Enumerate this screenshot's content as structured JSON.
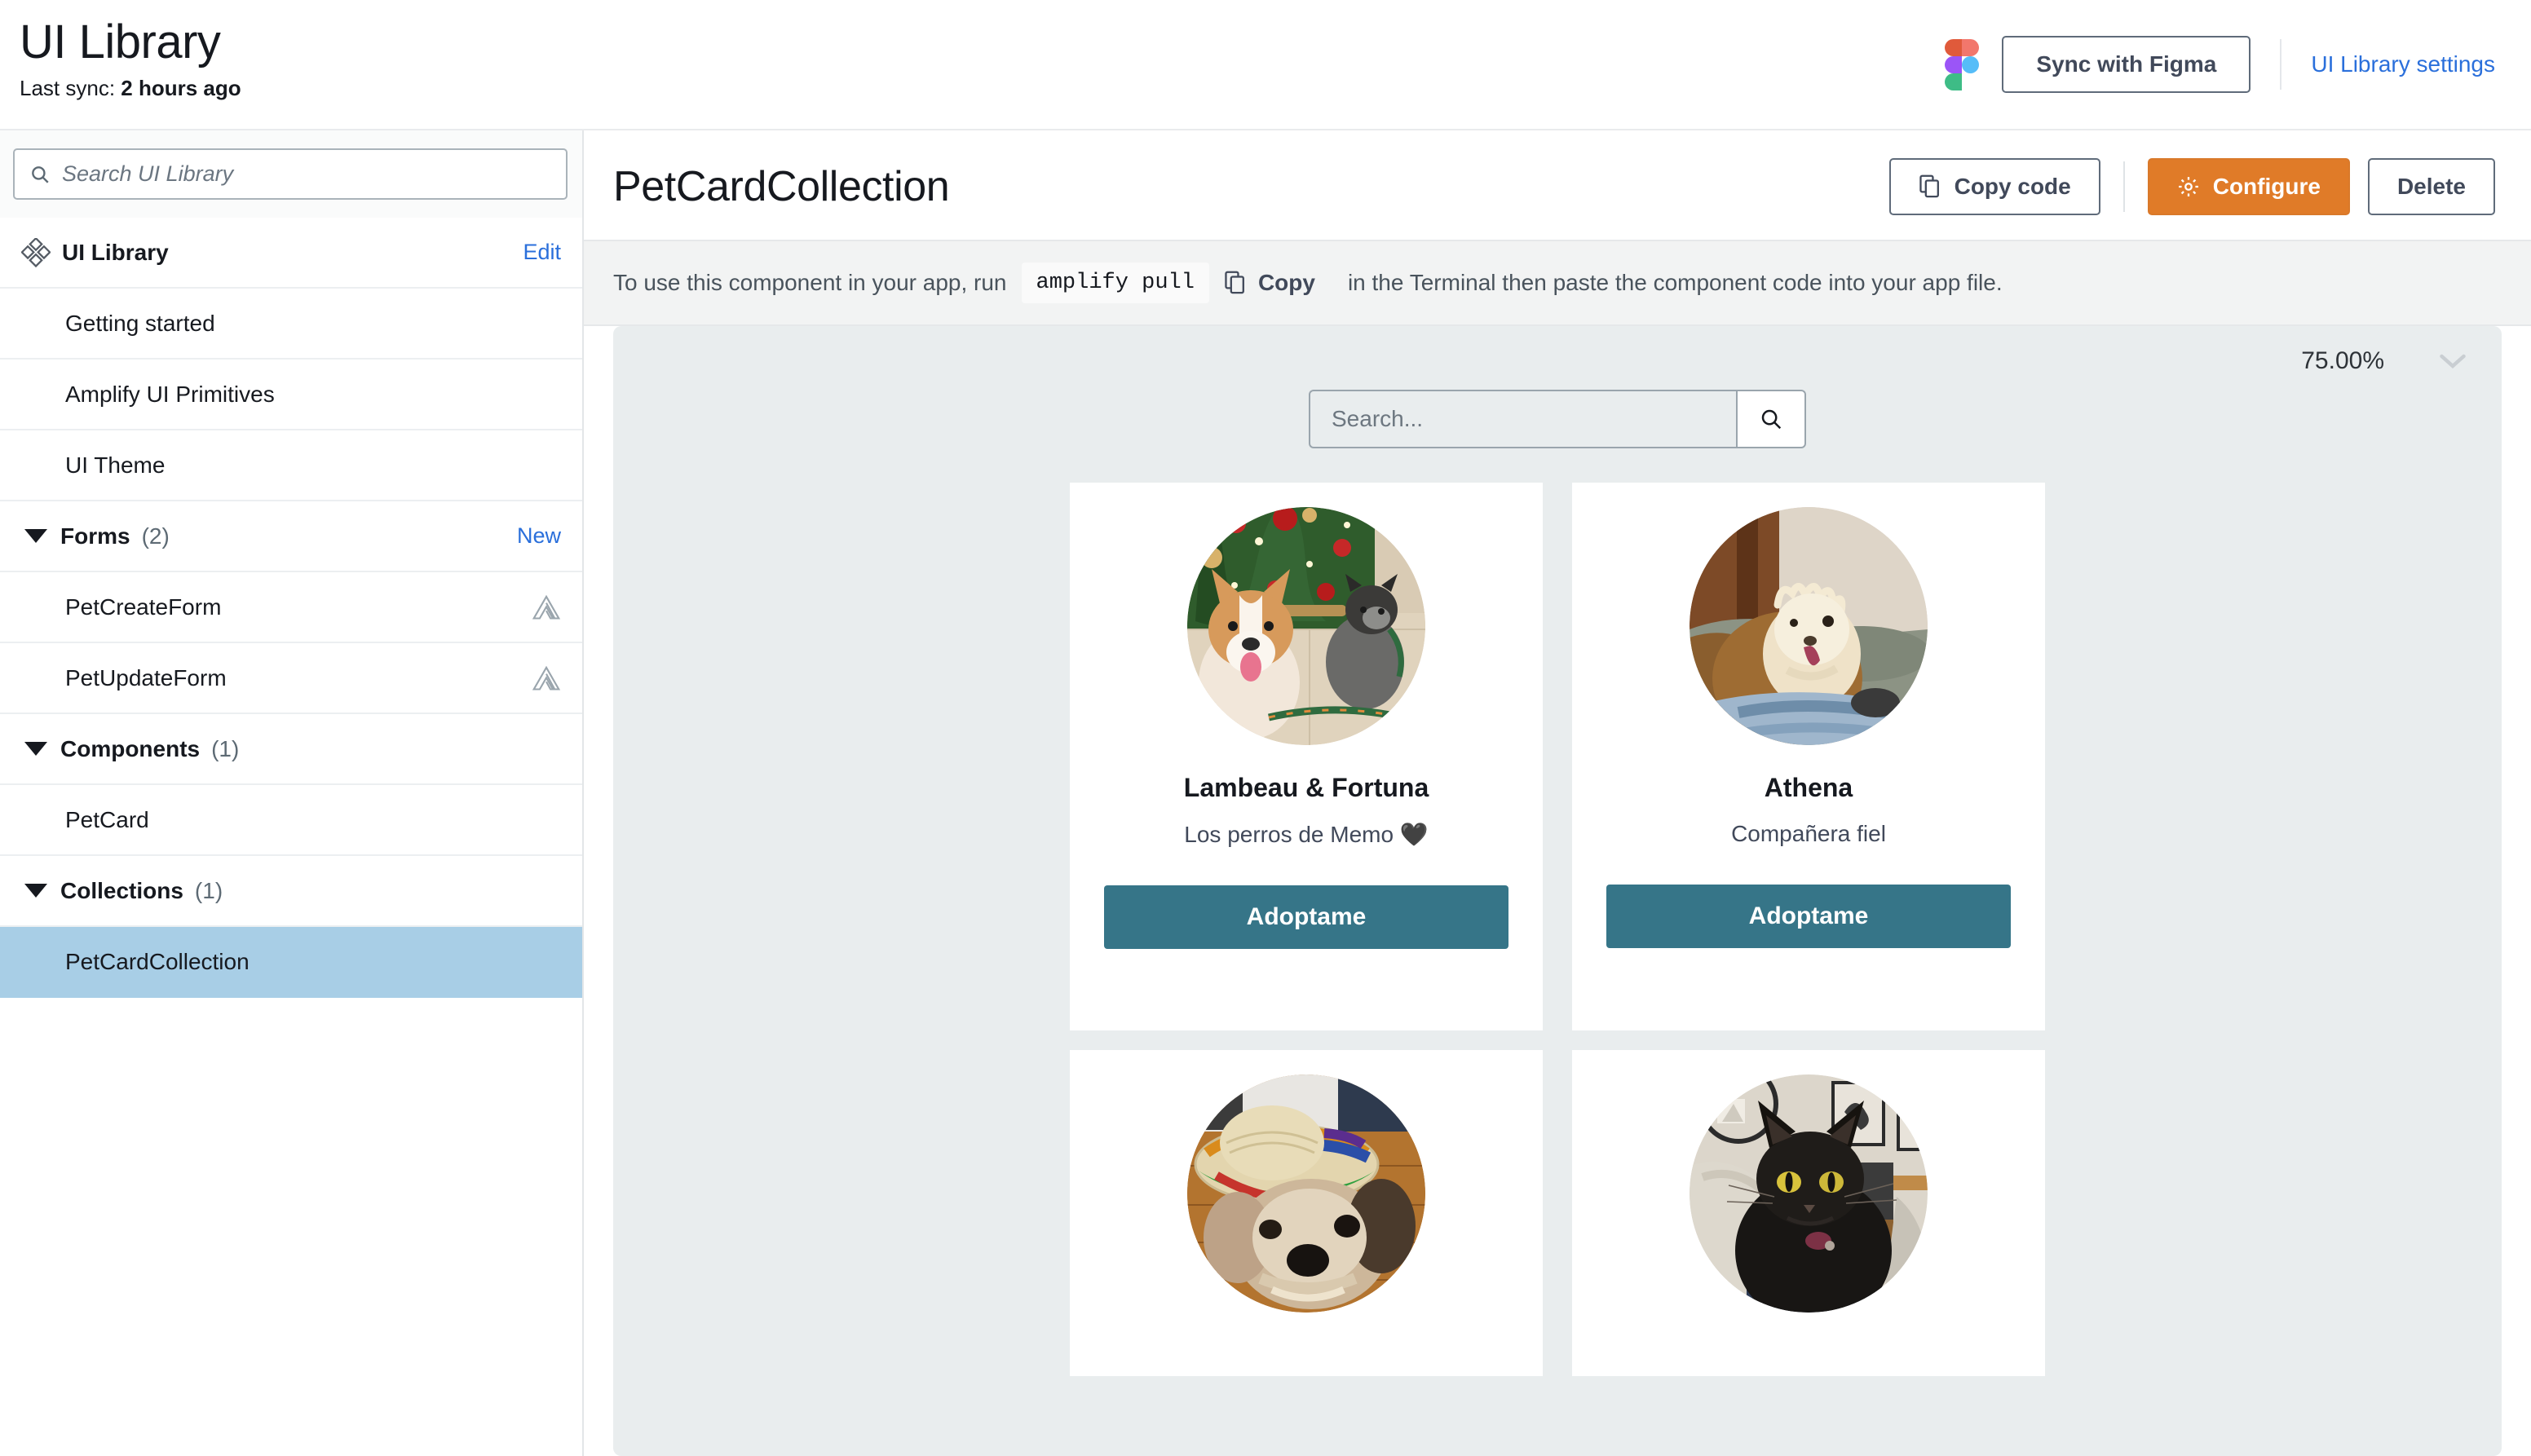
{
  "header": {
    "title": "UI Library",
    "last_sync_label": "Last sync:",
    "last_sync_value": "2 hours ago",
    "figma_icon": "figma-logo-icon",
    "sync_button": "Sync with Figma",
    "settings_link": "UI Library settings"
  },
  "sidebar": {
    "search_placeholder": "Search UI Library",
    "search_icon": "search-icon",
    "root": {
      "icon": "diamond-cluster-icon",
      "label": "UI Library",
      "action": "Edit"
    },
    "items": [
      {
        "label": "Getting started",
        "type": "link"
      },
      {
        "label": "Amplify UI Primitives",
        "type": "link"
      },
      {
        "label": "UI Theme",
        "type": "link"
      },
      {
        "label": "Forms",
        "count": "(2)",
        "type": "group",
        "action": "New",
        "caret": "caret-down-icon"
      },
      {
        "label": "PetCreateForm",
        "type": "child",
        "badge": "amplify-icon"
      },
      {
        "label": "PetUpdateForm",
        "type": "child",
        "badge": "amplify-icon"
      },
      {
        "label": "Components",
        "count": "(1)",
        "type": "group",
        "caret": "caret-down-icon"
      },
      {
        "label": "PetCard",
        "type": "child"
      },
      {
        "label": "Collections",
        "count": "(1)",
        "type": "group",
        "caret": "caret-down-icon"
      },
      {
        "label": "PetCardCollection",
        "type": "child",
        "selected": true
      }
    ]
  },
  "main": {
    "component_title": "PetCardCollection",
    "actions": {
      "copy_code": "Copy code",
      "copy_code_icon": "copy-icon",
      "configure": "Configure",
      "configure_icon": "gear-icon",
      "delete": "Delete"
    },
    "instruction": {
      "prefix": "To use this component in your app, run",
      "code": "amplify pull",
      "copy_label": "Copy",
      "copy_icon": "copy-icon",
      "suffix": "in the Terminal then paste the component code into your app file."
    },
    "preview": {
      "zoom_value": "75.00%",
      "zoom_chevron_icon": "chevron-down-icon",
      "search_placeholder": "Search...",
      "search_icon": "search-icon",
      "cards": [
        {
          "name": "Lambeau & Fortuna",
          "description": "Los perros de Memo 🖤",
          "button": "Adoptame",
          "image": "corgi-and-terrier-by-christmas-tree-photo"
        },
        {
          "name": "Athena",
          "description": "Compañera fiel",
          "button": "Adoptame",
          "image": "scruffy-cream-terrier-on-blanket-photo"
        },
        {
          "name": "",
          "description": "",
          "button": "",
          "image": "shih-tzu-wearing-sombrero-photo"
        },
        {
          "name": "",
          "description": "",
          "button": "",
          "image": "black-longhair-cat-photo"
        }
      ]
    }
  },
  "colors": {
    "accent_orange": "#e07b28",
    "link_blue": "#2a6fdb",
    "selected_blue": "#a8cee6",
    "adopt_teal": "#367588",
    "preview_bg": "#e9edee"
  }
}
